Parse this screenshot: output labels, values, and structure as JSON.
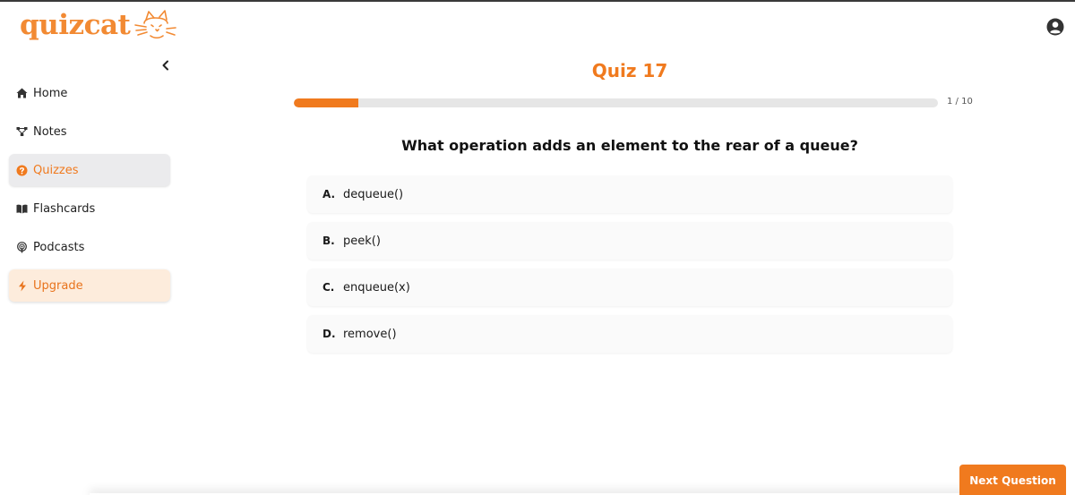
{
  "app": {
    "logo_text": "quizcat"
  },
  "colors": {
    "accent": "#f07a1e",
    "upgrade_bg": "#fdecdc",
    "active_bg": "#ebebed"
  },
  "sidebar": {
    "items": [
      {
        "label": "Home",
        "icon": "home-icon"
      },
      {
        "label": "Notes",
        "icon": "notes-icon"
      },
      {
        "label": "Quizzes",
        "icon": "question-circle-icon",
        "active": true
      },
      {
        "label": "Flashcards",
        "icon": "book-icon"
      },
      {
        "label": "Podcasts",
        "icon": "podcast-icon"
      },
      {
        "label": "Upgrade",
        "icon": "bolt-icon"
      }
    ]
  },
  "quiz": {
    "title": "Quiz 17",
    "progress_label": "1 / 10",
    "progress_fraction": 0.1,
    "question": "What operation adds an element to the rear of a queue?",
    "options": [
      {
        "letter": "A.",
        "text": "dequeue()"
      },
      {
        "letter": "B.",
        "text": "peek()"
      },
      {
        "letter": "C.",
        "text": "enqueue(x)"
      },
      {
        "letter": "D.",
        "text": "remove()"
      }
    ]
  },
  "footer": {
    "next_label": "Next Question"
  }
}
